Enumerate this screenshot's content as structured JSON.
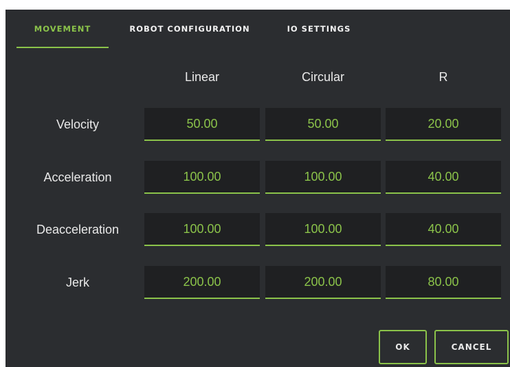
{
  "tabs": [
    {
      "label": "MOVEMENT",
      "active": true
    },
    {
      "label": "ROBOT CONFIGURATION",
      "active": false
    },
    {
      "label": "IO SETTINGS",
      "active": false
    }
  ],
  "columns": [
    "Linear",
    "Circular",
    "R"
  ],
  "rows": [
    {
      "label": "Velocity",
      "values": [
        "50.00",
        "50.00",
        "20.00"
      ]
    },
    {
      "label": "Acceleration",
      "values": [
        "100.00",
        "100.00",
        "40.00"
      ]
    },
    {
      "label": "Deacceleration",
      "values": [
        "100.00",
        "100.00",
        "40.00"
      ]
    },
    {
      "label": "Jerk",
      "values": [
        "200.00",
        "200.00",
        "80.00"
      ]
    }
  ],
  "buttons": {
    "ok_label": "OK",
    "cancel_label": "CANCEL"
  },
  "colors": {
    "accent": "#8bc34a",
    "background": "#2b2d30",
    "field_background": "#1f2022",
    "text": "#e9e9e9"
  }
}
